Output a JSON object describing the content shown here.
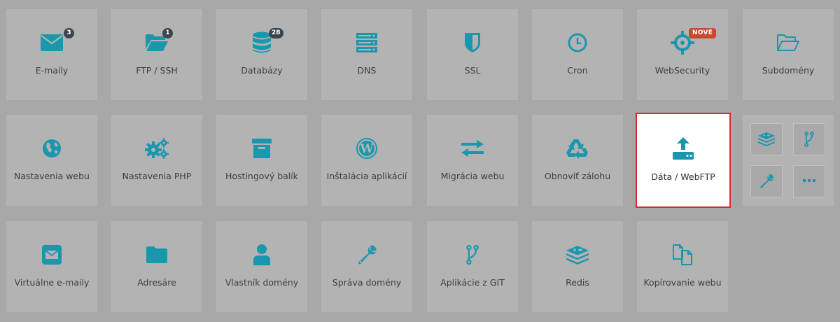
{
  "accent": "#1b97ad",
  "tiles": {
    "emails": {
      "label": "E-maily",
      "icon": "envelope-icon",
      "badge": "3"
    },
    "ftp": {
      "label": "FTP / SSH",
      "icon": "folder-open-icon",
      "badge": "1"
    },
    "databases": {
      "label": "Databázy",
      "icon": "database-icon",
      "badge": "28"
    },
    "dns": {
      "label": "DNS",
      "icon": "server-icon"
    },
    "ssl": {
      "label": "SSL",
      "icon": "shield-icon"
    },
    "cron": {
      "label": "Cron",
      "icon": "clock-icon"
    },
    "websecurity": {
      "label": "WebSecurity",
      "icon": "crosshair-icon",
      "badge": "NOVÉ"
    },
    "subdomains": {
      "label": "Subdomény",
      "icon": "folder-outline-icon"
    },
    "web_settings": {
      "label": "Nastavenia webu",
      "icon": "globe-icon"
    },
    "php_settings": {
      "label": "Nastavenia PHP",
      "icon": "gears-icon"
    },
    "hosting": {
      "label": "Hostingový balík",
      "icon": "archive-box-icon"
    },
    "apps": {
      "label": "Inštalácia aplikácií",
      "icon": "wordpress-icon"
    },
    "migration": {
      "label": "Migrácia webu",
      "icon": "exchange-arrows-icon"
    },
    "backup": {
      "label": "Obnoviť zálohu",
      "icon": "recycle-icon"
    },
    "webftp": {
      "label": "Dáta / WebFTP",
      "icon": "upload-drive-icon",
      "active": true
    },
    "virtual_mail": {
      "label": "Virtuálne e-maily",
      "icon": "envelope-square-icon"
    },
    "directories": {
      "label": "Adresáre",
      "icon": "folder-icon"
    },
    "owner": {
      "label": "Vlastník domény",
      "icon": "user-icon"
    },
    "domain_admin": {
      "label": "Správa domény",
      "icon": "wrench-icon"
    },
    "git_apps": {
      "label": "Aplikácie z GIT",
      "icon": "code-branch-icon"
    },
    "redis": {
      "label": "Redis",
      "icon": "redis-stack-icon"
    },
    "copy_web": {
      "label": "Kopírovanie webu",
      "icon": "copy-files-icon"
    }
  },
  "mini_tiles": [
    "redis-stack-icon",
    "code-branch-icon",
    "wrench-icon",
    "more-dots-icon"
  ]
}
